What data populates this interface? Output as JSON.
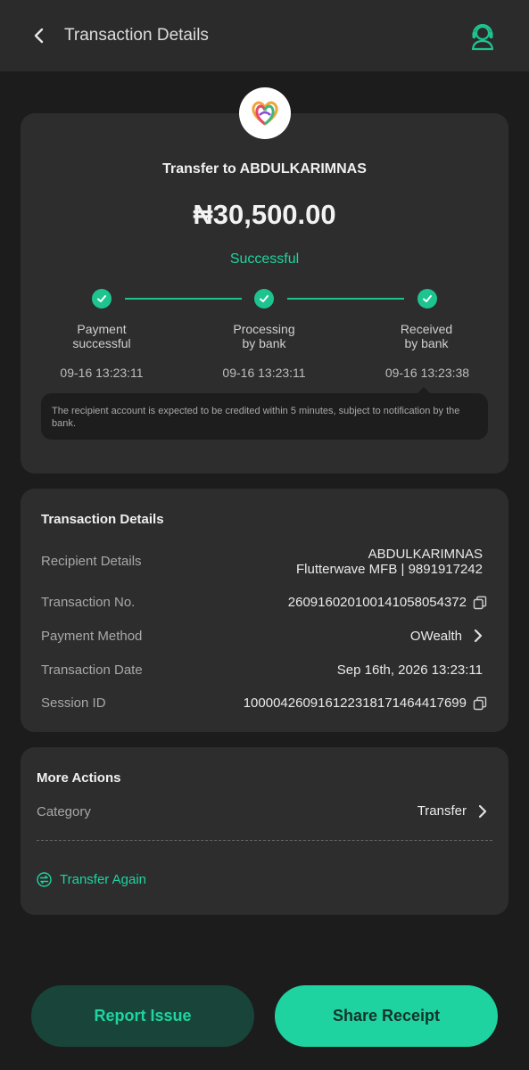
{
  "header": {
    "title": "Transaction Details",
    "back_icon": "chevron-left-icon",
    "support_icon": "customer-support-icon"
  },
  "summary": {
    "logo_icon": "opay-logo",
    "transfer_to": "Transfer to ABDULKARIMNAS",
    "amount": "₦30,500.00",
    "status": "Successful",
    "steps": [
      {
        "label_line1": "Payment",
        "label_line2": "successful",
        "time": "09-16 13:23:11"
      },
      {
        "label_line1": "Processing",
        "label_line2": "by bank",
        "time": "09-16 13:23:11"
      },
      {
        "label_line1": "Received",
        "label_line2": "by bank",
        "time": "09-16 13:23:38"
      }
    ],
    "note": "The recipient account is expected to be credited within 5 minutes, subject to notification by the bank."
  },
  "details": {
    "title": "Transaction Details",
    "recipient_label": "Recipient Details",
    "recipient_name": "ABDULKARIMNAS",
    "recipient_bank": "Flutterwave MFB | 9891917242",
    "txn_no_label": "Transaction No.",
    "txn_no": "260916020100141058054372",
    "payment_method_label": "Payment Method",
    "payment_method": "OWealth",
    "date_label": "Transaction Date",
    "date": "Sep 16th, 2026 13:23:11",
    "session_label": "Session ID",
    "session_id": "100004260916122318171464417699"
  },
  "more_actions": {
    "title": "More Actions",
    "category_label": "Category",
    "category_value": "Transfer",
    "transfer_again": "Transfer Again"
  },
  "buttons": {
    "report": "Report Issue",
    "share": "Share Receipt"
  },
  "colors": {
    "accent": "#1ed49f",
    "background": "#1c1c1c",
    "card": "#2d2d2d",
    "report_button_bg": "#18443a",
    "share_button_bg": "#1ed3a0"
  }
}
